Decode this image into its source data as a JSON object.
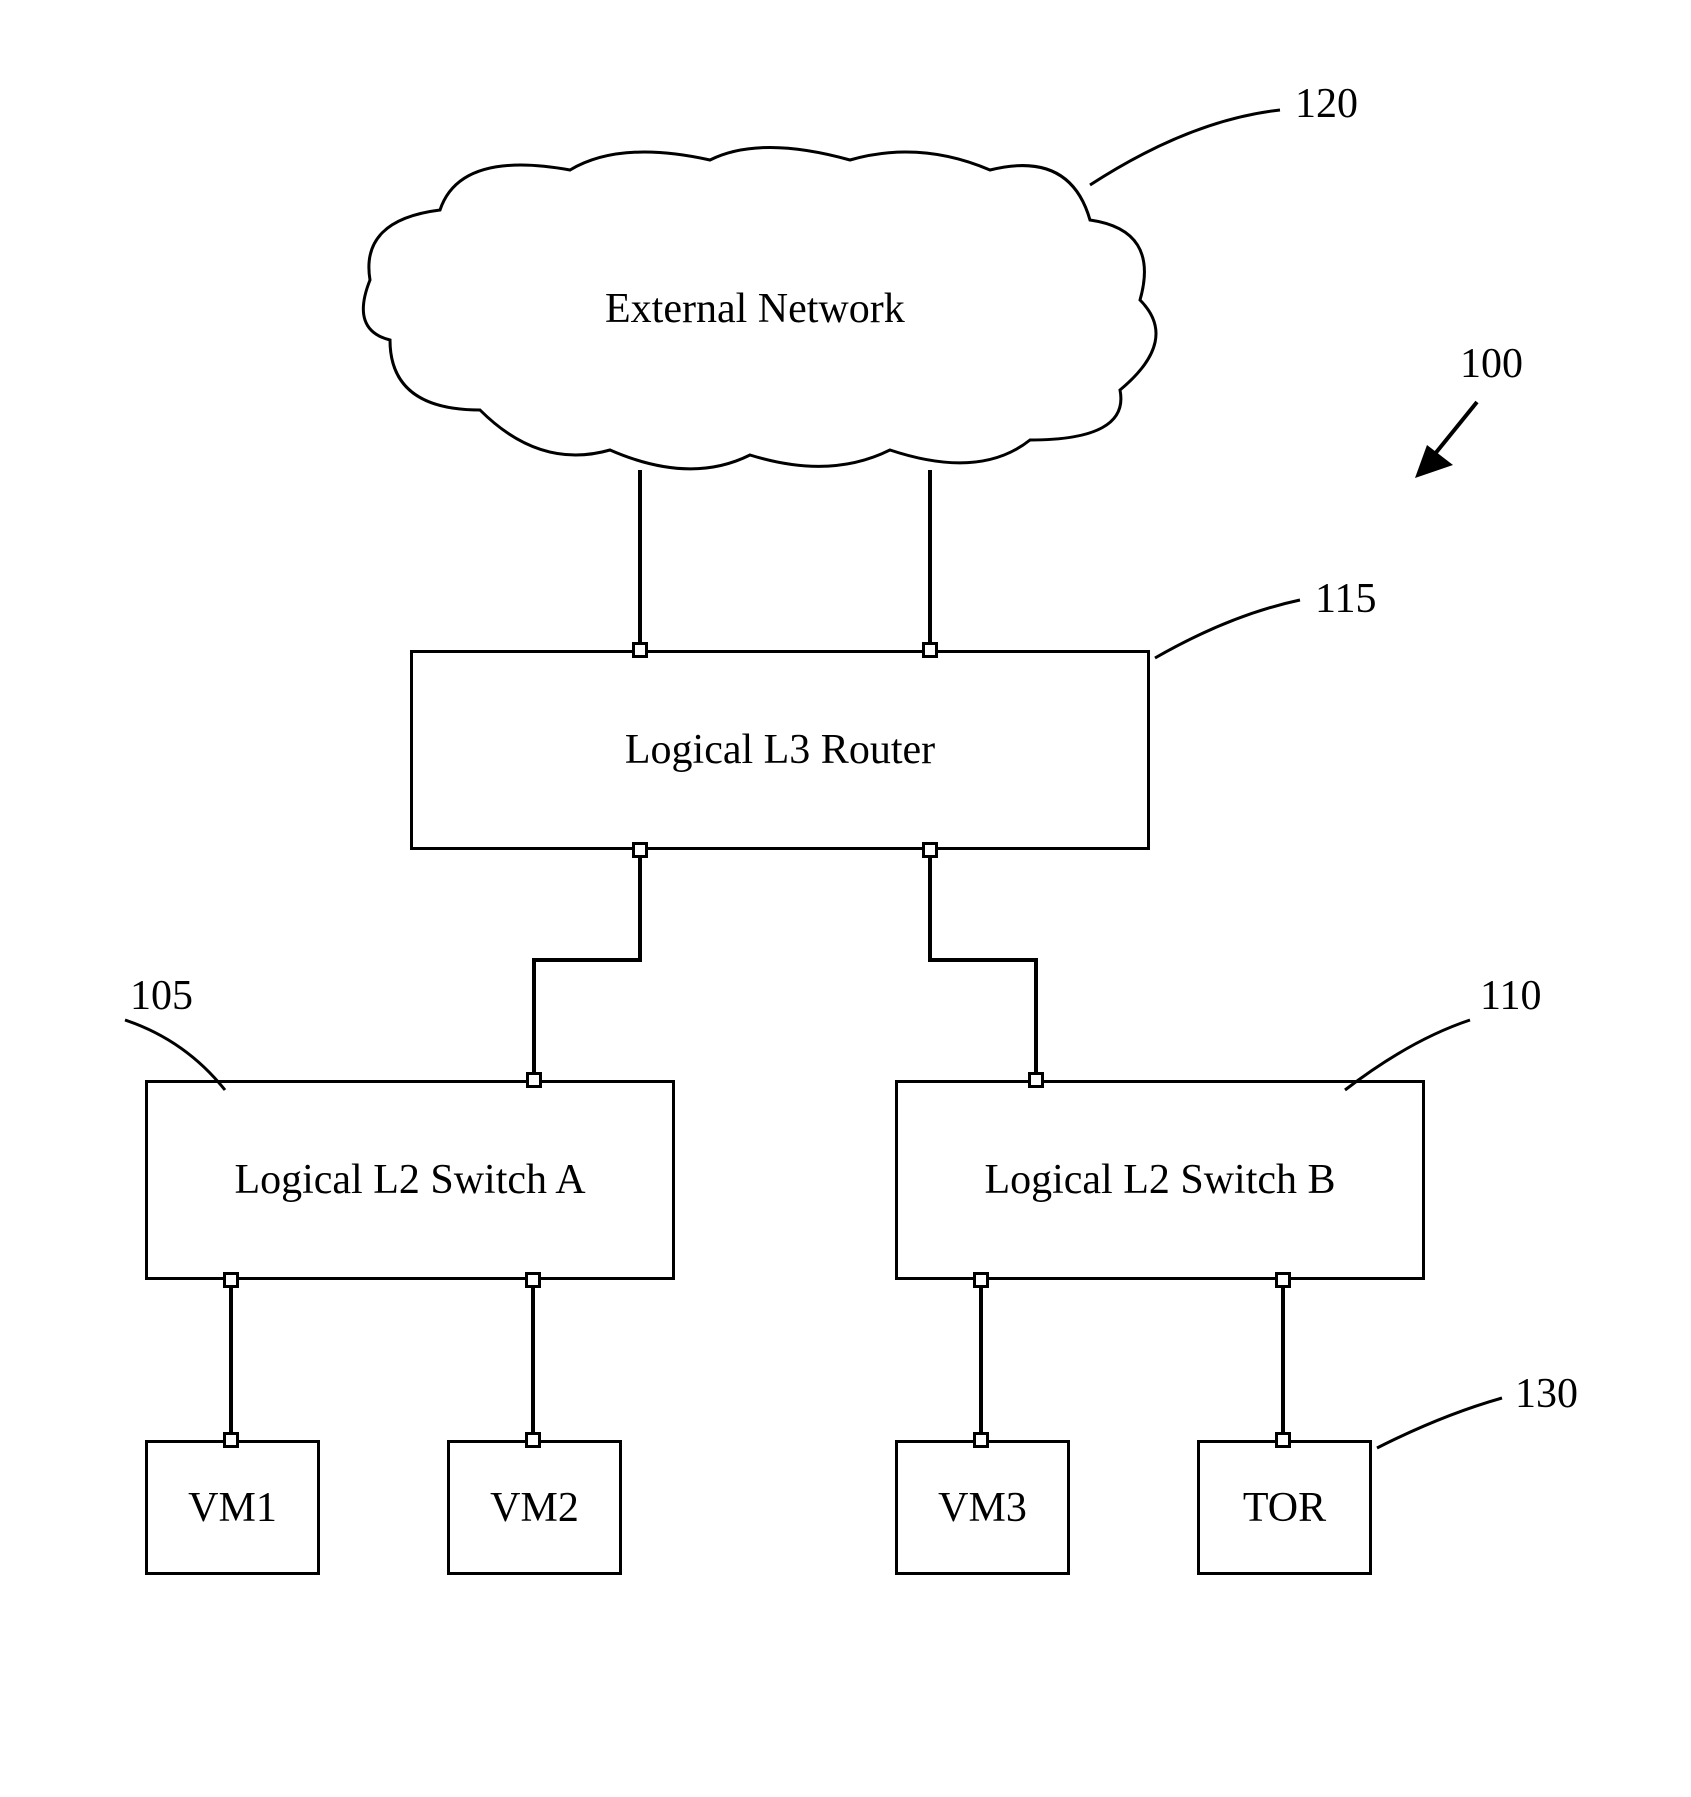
{
  "cloud": {
    "label": "External Network"
  },
  "router": {
    "label": "Logical L3 Router"
  },
  "switchA": {
    "label": "Logical L2 Switch A"
  },
  "switchB": {
    "label": "Logical L2 Switch B"
  },
  "vm1": {
    "label": "VM1"
  },
  "vm2": {
    "label": "VM2"
  },
  "vm3": {
    "label": "VM3"
  },
  "tor": {
    "label": "TOR"
  },
  "refs": {
    "cloud": "120",
    "figure": "100",
    "router": "115",
    "switchA": "105",
    "switchB": "110",
    "tor": "130"
  }
}
